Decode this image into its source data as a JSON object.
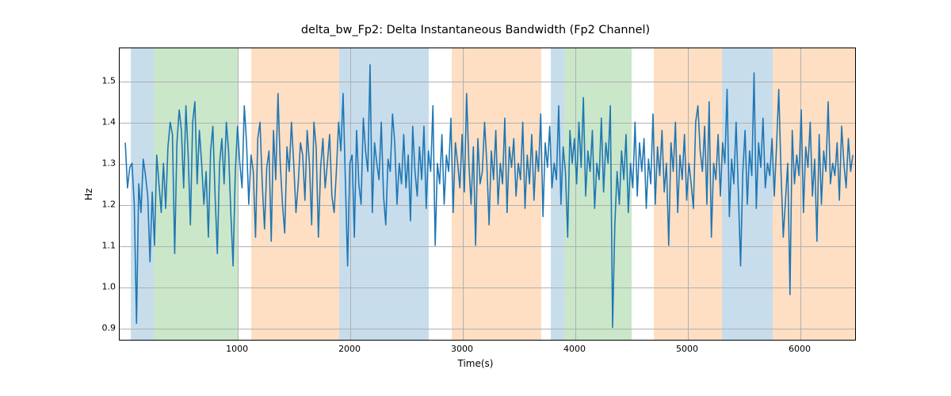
{
  "chart_data": {
    "type": "line",
    "title": "delta_bw_Fp2: Delta Instantaneous Bandwidth (Fp2 Channel)",
    "xlabel": "Time(s)",
    "ylabel": "Hz",
    "xlim": [
      -50,
      6500
    ],
    "ylim": [
      0.87,
      1.58
    ],
    "xticks": [
      1000,
      2000,
      3000,
      4000,
      5000,
      6000
    ],
    "yticks": [
      0.9,
      1.0,
      1.1,
      1.2,
      1.3,
      1.4,
      1.5
    ],
    "bands": [
      {
        "x0": 50,
        "x1": 250,
        "color": "#1f77b4"
      },
      {
        "x0": 250,
        "x1": 1000,
        "color": "#2ca02c"
      },
      {
        "x0": 1120,
        "x1": 1900,
        "color": "#ff7f0e"
      },
      {
        "x0": 1900,
        "x1": 2700,
        "color": "#1f77b4"
      },
      {
        "x0": 2700,
        "x1": 2900,
        "color": "#ffffff"
      },
      {
        "x0": 2900,
        "x1": 3700,
        "color": "#ff7f0e"
      },
      {
        "x0": 3780,
        "x1": 3900,
        "color": "#1f77b4"
      },
      {
        "x0": 3900,
        "x1": 4500,
        "color": "#2ca02c"
      },
      {
        "x0": 4700,
        "x1": 5300,
        "color": "#ff7f0e"
      },
      {
        "x0": 5300,
        "x1": 5750,
        "color": "#1f77b4"
      },
      {
        "x0": 5750,
        "x1": 6500,
        "color": "#ff7f0e"
      }
    ],
    "series": [
      {
        "name": "delta_bw_Fp2",
        "color": "#1f77b4",
        "x_step": 20,
        "x_start": 0,
        "values": [
          1.35,
          1.24,
          1.29,
          1.3,
          1.2,
          0.91,
          1.25,
          1.18,
          1.31,
          1.27,
          1.22,
          1.06,
          1.23,
          1.1,
          1.32,
          1.25,
          1.18,
          1.3,
          1.19,
          1.34,
          1.4,
          1.37,
          1.08,
          1.35,
          1.43,
          1.38,
          1.24,
          1.44,
          1.32,
          1.15,
          1.4,
          1.45,
          1.25,
          1.38,
          1.3,
          1.2,
          1.28,
          1.12,
          1.33,
          1.39,
          1.22,
          1.08,
          1.3,
          1.36,
          1.25,
          1.4,
          1.33,
          1.18,
          1.05,
          1.28,
          1.39,
          1.3,
          1.24,
          1.44,
          1.35,
          1.2,
          1.32,
          1.28,
          1.12,
          1.36,
          1.4,
          1.25,
          1.14,
          1.29,
          1.33,
          1.11,
          1.38,
          1.26,
          1.47,
          1.3,
          1.2,
          1.13,
          1.34,
          1.28,
          1.4,
          1.3,
          1.18,
          1.25,
          1.35,
          1.32,
          1.21,
          1.38,
          1.3,
          1.15,
          1.4,
          1.34,
          1.12,
          1.29,
          1.36,
          1.24,
          1.3,
          1.37,
          1.22,
          1.18,
          1.28,
          1.4,
          1.33,
          1.47,
          1.26,
          1.05,
          1.3,
          1.32,
          1.12,
          1.38,
          1.25,
          1.2,
          1.41,
          1.33,
          1.28,
          1.54,
          1.18,
          1.35,
          1.3,
          1.26,
          1.4,
          1.22,
          1.15,
          1.31,
          1.28,
          1.42,
          1.35,
          1.2,
          1.3,
          1.25,
          1.37,
          1.24,
          1.32,
          1.16,
          1.39,
          1.28,
          1.22,
          1.34,
          1.26,
          1.39,
          1.19,
          1.33,
          1.28,
          1.44,
          1.1,
          1.3,
          1.25,
          1.37,
          1.2,
          1.32,
          1.28,
          1.41,
          1.18,
          1.35,
          1.3,
          1.24,
          1.37,
          1.23,
          1.47,
          1.3,
          1.2,
          1.34,
          1.1,
          1.36,
          1.25,
          1.28,
          1.4,
          1.3,
          1.15,
          1.33,
          1.26,
          1.38,
          1.2,
          1.3,
          1.25,
          1.41,
          1.18,
          1.34,
          1.29,
          1.36,
          1.22,
          1.3,
          1.26,
          1.4,
          1.19,
          1.32,
          1.25,
          1.37,
          1.21,
          1.33,
          1.28,
          1.42,
          1.17,
          1.35,
          1.29,
          1.39,
          1.24,
          1.3,
          1.26,
          1.44,
          1.2,
          1.34,
          1.28,
          1.12,
          1.38,
          1.3,
          1.36,
          1.25,
          1.4,
          1.29,
          1.46,
          1.22,
          1.33,
          1.28,
          1.38,
          1.19,
          1.3,
          1.26,
          1.41,
          1.23,
          1.35,
          1.3,
          1.44,
          0.9,
          1.15,
          1.28,
          1.2,
          1.33,
          1.26,
          1.37,
          1.18,
          1.3,
          1.24,
          1.4,
          1.22,
          1.35,
          1.28,
          1.36,
          1.19,
          1.31,
          1.25,
          1.42,
          1.2,
          1.34,
          1.27,
          1.38,
          1.23,
          1.3,
          1.1,
          1.35,
          1.28,
          1.4,
          1.18,
          1.32,
          1.26,
          1.37,
          1.21,
          1.3,
          1.25,
          1.19,
          1.4,
          1.44,
          1.33,
          1.28,
          1.39,
          1.2,
          1.45,
          1.12,
          1.3,
          1.26,
          1.37,
          1.22,
          1.35,
          1.3,
          1.48,
          1.17,
          1.31,
          1.25,
          1.4,
          1.23,
          1.05,
          1.28,
          1.38,
          1.2,
          1.33,
          1.27,
          1.52,
          1.19,
          1.35,
          1.29,
          1.41,
          1.24,
          1.3,
          1.27,
          1.36,
          1.22,
          1.34,
          1.48,
          1.28,
          1.12,
          1.21,
          1.3,
          0.98,
          1.38,
          1.25,
          1.32,
          1.27,
          1.43,
          1.18,
          1.34,
          1.29,
          1.4,
          1.22,
          1.31,
          1.11,
          1.37,
          1.2,
          1.33,
          1.28,
          1.45,
          1.25,
          1.3,
          1.27,
          1.35,
          1.21,
          1.39,
          1.3,
          1.24,
          1.36,
          1.28,
          1.32
        ]
      }
    ]
  },
  "layout": {
    "fig_w": 1200,
    "fig_h": 500,
    "ax_left": 150,
    "ax_top": 60,
    "ax_w": 930,
    "ax_h": 370
  }
}
